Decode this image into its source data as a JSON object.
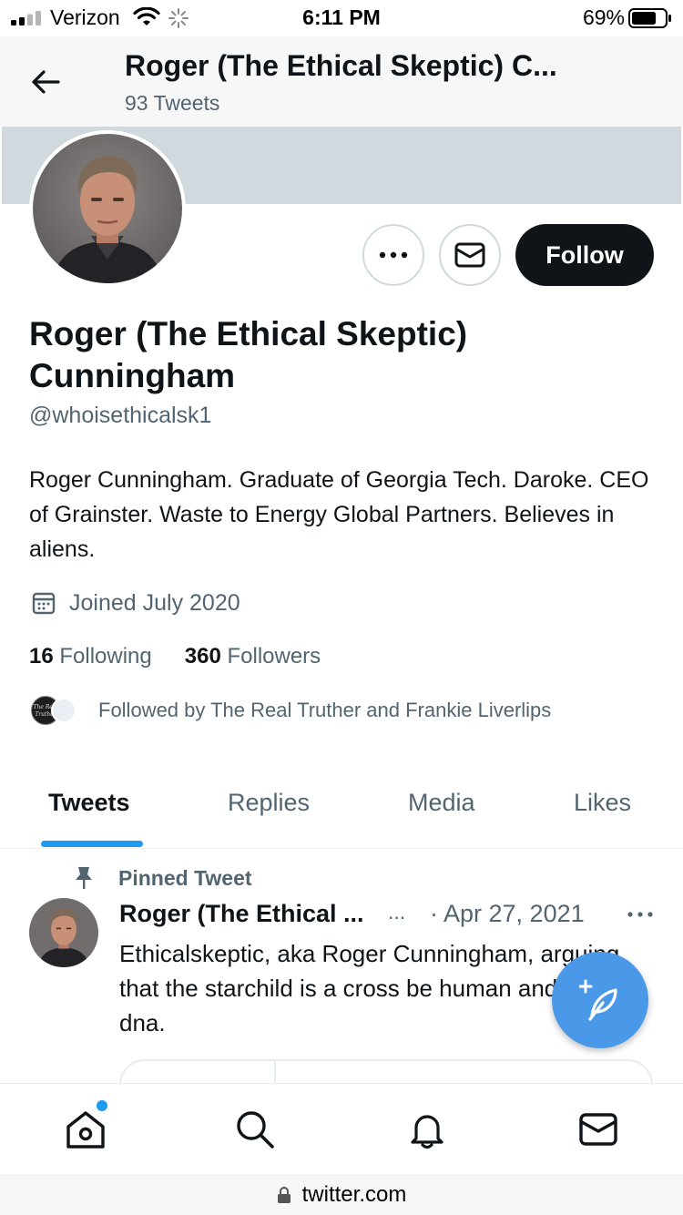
{
  "status_bar": {
    "carrier": "Verizon",
    "time": "6:11 PM",
    "battery_percent": "69%"
  },
  "header": {
    "title": "Roger (The Ethical Skeptic) C...",
    "tweet_count": "93 Tweets"
  },
  "profile": {
    "name": "Roger (The Ethical Skeptic) Cunningham",
    "handle": "@whoisethicalsk1",
    "bio": "Roger Cunningham. Graduate of Georgia Tech. Daroke. CEO of Grainster. Waste to Energy Global Partners. Believes in aliens.",
    "joined": "Joined July 2020",
    "following_count": "16",
    "following_label": "Following",
    "followers_count": "360",
    "followers_label": "Followers",
    "followed_by": "Followed by The Real Truther and Frankie Liverlips",
    "mini_avatar_text": "The Real Truther"
  },
  "actions": {
    "follow_label": "Follow"
  },
  "tabs": [
    {
      "label": "Tweets",
      "active": true
    },
    {
      "label": "Replies",
      "active": false
    },
    {
      "label": "Media",
      "active": false
    },
    {
      "label": "Likes",
      "active": false
    }
  ],
  "pinned_tweet": {
    "pinned_label": "Pinned Tweet",
    "author": "Roger (The Ethical ...",
    "ellipsis": "...",
    "date": "· Apr 27, 2021",
    "text": "Ethicalskeptic, aka Roger Cunningham, arguing that the starchild is a cross be human and alien dna."
  },
  "bottom_nav": [
    "home-icon",
    "search-icon",
    "bell-icon",
    "mail-icon"
  ],
  "url_bar": {
    "domain": "twitter.com"
  },
  "colors": {
    "accent": "#1d9bf0",
    "fab": "#4a99e9",
    "banner": "#cfd9de",
    "text_primary": "#0f1419",
    "text_secondary": "#536471"
  }
}
